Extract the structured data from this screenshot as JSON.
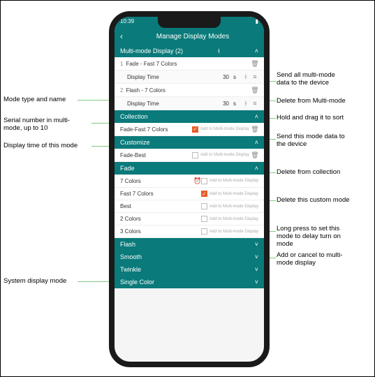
{
  "status": {
    "time": "10:39"
  },
  "header": {
    "title": "Manage Display Modes"
  },
  "multimode": {
    "title": "Multi-mode Display (2)",
    "items": [
      {
        "serial": "1",
        "name": "Fade - Fast 7 Colors",
        "display_label": "Display Time",
        "display_value": "30",
        "unit": "s"
      },
      {
        "serial": "2",
        "name": "Flash - 7 Colors",
        "display_label": "Display Time",
        "display_value": "30",
        "unit": "s"
      }
    ]
  },
  "collection": {
    "title": "Collection",
    "items": [
      {
        "name": "Fade-Fast 7 Colors",
        "checked": true,
        "addtxt": "Add to Multi-mode Display"
      }
    ]
  },
  "customize": {
    "title": "Customize",
    "items": [
      {
        "name": "Fade-Best",
        "checked": false,
        "addtxt": "Add to Multi-mode Display"
      }
    ]
  },
  "fade": {
    "title": "Fade",
    "items": [
      {
        "name": "7 Colors",
        "clock": true,
        "checked": false,
        "addtxt": "Add to Multi-mode Display"
      },
      {
        "name": "Fast 7 Colors",
        "checked": true,
        "addtxt": "Add to Multi-mode Display"
      },
      {
        "name": "Best",
        "checked": false,
        "addtxt": "Add to Multi-mode Display"
      },
      {
        "name": "2 Colors",
        "checked": false,
        "addtxt": "Add to Multi-mode Display"
      },
      {
        "name": "3 Colors",
        "checked": false,
        "addtxt": "Add to Multi-mode Display"
      }
    ]
  },
  "groups": [
    {
      "title": "Flash"
    },
    {
      "title": "Smooth"
    },
    {
      "title": "Twinkle"
    },
    {
      "title": "Single Color"
    }
  ],
  "annotations": {
    "left": [
      "Mode type and name",
      "Serial number in multi-\nmode, up to 10",
      "Display time of this mode",
      "System display mode"
    ],
    "right": [
      "Send all multi-mode\ndata to the device",
      "Delete from Multi-mode",
      "Hold and drag it to sort",
      "Send this mode data to\nthe device",
      "Delete from collection",
      "Delete this custom mode",
      "Long press to set this\nmode to delay turn on\nmode",
      "Add or cancel to multi-\nmode display"
    ]
  }
}
